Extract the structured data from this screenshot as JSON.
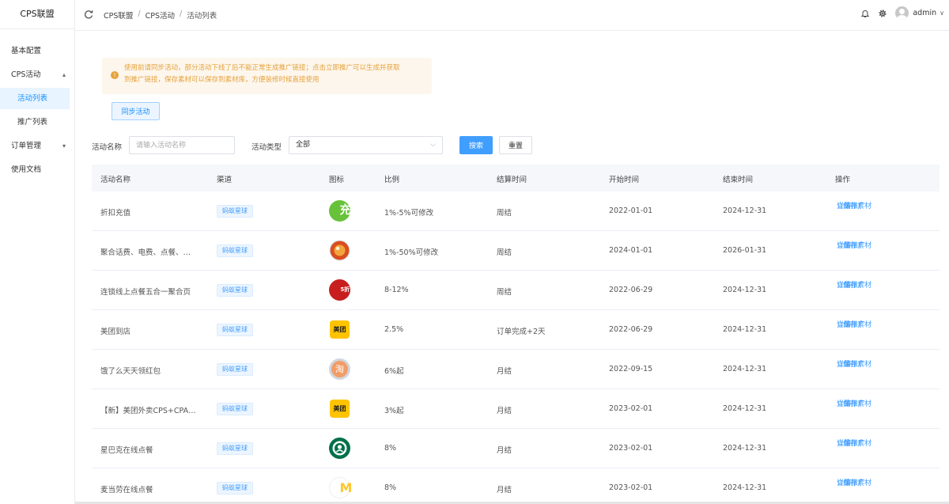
{
  "sidebar": {
    "logo": "CPS联盟",
    "items": [
      {
        "label": "基本配置"
      },
      {
        "label": "CPS活动",
        "arrow": "▴"
      },
      {
        "label": "活动列表"
      },
      {
        "label": "推广列表"
      },
      {
        "label": "订单管理",
        "arrow": "▾"
      },
      {
        "label": "使用文档"
      }
    ]
  },
  "header": {
    "breadcrumb": [
      "CPS联盟",
      "CPS活动",
      "活动列表"
    ],
    "breadcrumb_sep": "/",
    "user": "admin",
    "user_chevron": "∨"
  },
  "notice": {
    "icon": "!",
    "line1": "使用前请同步活动，部分活动下线了后不能正常生成推广链接；点击立即推广可以生成并获取",
    "line2": "到推广链接，保存素材可以保存到素材库，方便装修时候直接使用"
  },
  "toolbar": {
    "sync_label": "同步活动"
  },
  "search": {
    "name_label": "活动名称",
    "name_placeholder": "请输入活动名称",
    "type_label": "活动类型",
    "type_value": "全部",
    "type_chevron": "⌵",
    "search_label": "搜索",
    "reset_label": "重置"
  },
  "table": {
    "headers": [
      "活动名称",
      "渠道",
      "图标",
      "比例",
      "结算时间",
      "开始时间",
      "结束时间",
      "操作"
    ],
    "ops": {
      "detail": "详情",
      "promote": "立即推广",
      "save": "保存素材"
    },
    "rows": [
      {
        "name": "折扣充值",
        "channel": "蚂蚁星球",
        "icon": "charge-icon",
        "icon_text": "充",
        "ratio": "1%-5%可修改",
        "settle": "周结",
        "start": "2022-01-01",
        "end": "2024-12-31"
      },
      {
        "name": "聚合话费、电费、点餐、…",
        "channel": "蚂蚁星球",
        "icon": "lobster-icon",
        "icon_text": "",
        "ratio": "1%-50%可修改",
        "settle": "周结",
        "start": "2024-01-01",
        "end": "2026-01-31"
      },
      {
        "name": "连锁线上点餐五合一聚合页",
        "channel": "蚂蚁星球",
        "icon": "discount-5-icon",
        "icon_text": "5折起",
        "ratio": "8-12%",
        "settle": "周结",
        "start": "2022-06-29",
        "end": "2024-12-31"
      },
      {
        "name": "美团到店",
        "channel": "蚂蚁星球",
        "icon": "meituan-icon",
        "icon_text": "美团",
        "ratio": "2.5%",
        "settle": "订单完成+2天",
        "start": "2022-06-29",
        "end": "2024-12-31"
      },
      {
        "name": "饿了么天天领红包",
        "channel": "蚂蚁星球",
        "icon": "taobao-icon",
        "icon_text": "淘",
        "ratio": "6%起",
        "settle": "月结",
        "start": "2022-09-15",
        "end": "2024-12-31"
      },
      {
        "name": "【新】美团外卖CPS+CPA…",
        "channel": "蚂蚁星球",
        "icon": "meituan-icon",
        "icon_text": "美团",
        "ratio": "3%起",
        "settle": "月结",
        "start": "2023-02-01",
        "end": "2024-12-31"
      },
      {
        "name": "星巴克在线点餐",
        "channel": "蚂蚁星球",
        "icon": "starbucks-icon",
        "icon_text": "",
        "ratio": "8%",
        "settle": "月结",
        "start": "2023-02-01",
        "end": "2024-12-31"
      },
      {
        "name": "麦当劳在线点餐",
        "channel": "蚂蚁星球",
        "icon": "mcdonalds-icon",
        "icon_text": "M",
        "ratio": "8%",
        "settle": "月结",
        "start": "2023-02-01",
        "end": "2024-12-31"
      }
    ]
  }
}
